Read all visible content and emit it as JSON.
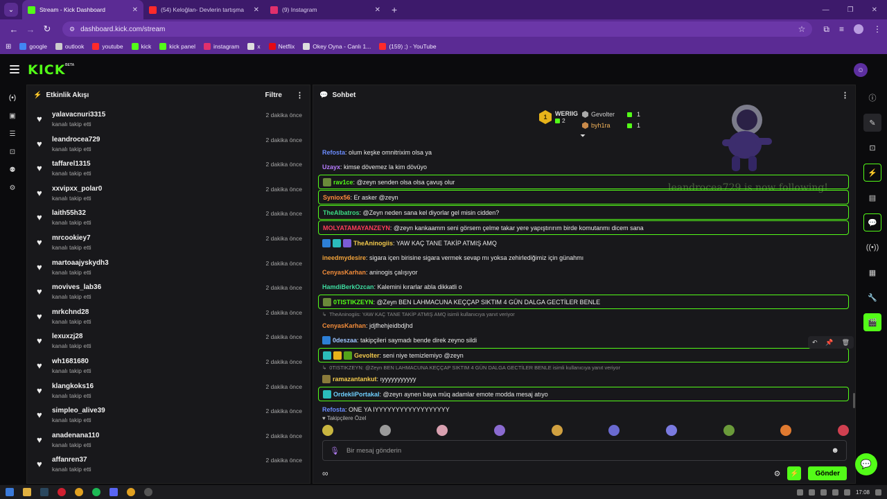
{
  "browser": {
    "tabs": [
      {
        "title": "Stream - Kick Dashboard",
        "active": true,
        "icon": "kick-icon"
      },
      {
        "title": "(54) Keloğlan- Devlerin tartışma",
        "active": false,
        "icon": "youtube-icon"
      },
      {
        "title": "(9) Instagram",
        "active": false,
        "icon": "instagram-icon"
      }
    ],
    "new_tab": "+",
    "url": "dashboard.kick.com/stream",
    "bookmarks": [
      "google",
      "outlook",
      "youtube",
      "kick",
      "kick panel",
      "instagram",
      "x",
      "Netflix",
      "Okey Oyna - Canlı 1...",
      "(159) ;) - YouTube"
    ]
  },
  "app": {
    "logo": "KICK",
    "logo_beta": "BETA",
    "activity": {
      "title": "Etkinlik Akışı",
      "filter": "Filtre",
      "items": [
        {
          "name": "yalavacnuri3315",
          "action": "kanalı takip etti",
          "time": "2 dakika önce"
        },
        {
          "name": "leandrocea729",
          "action": "kanalı takip etti",
          "time": "2 dakika önce"
        },
        {
          "name": "taffarel1315",
          "action": "kanalı takip etti",
          "time": "2 dakika önce"
        },
        {
          "name": "xxvipxx_polar0",
          "action": "kanalı takip etti",
          "time": "2 dakika önce"
        },
        {
          "name": "laith55h32",
          "action": "kanalı takip etti",
          "time": "2 dakika önce"
        },
        {
          "name": "mrcookiey7",
          "action": "kanalı takip etti",
          "time": "2 dakika önce"
        },
        {
          "name": "martoaajyskydh3",
          "action": "kanalı takip etti",
          "time": "2 dakika önce"
        },
        {
          "name": "movives_lab36",
          "action": "kanalı takip etti",
          "time": "2 dakika önce"
        },
        {
          "name": "mrkchnd28",
          "action": "kanalı takip etti",
          "time": "2 dakika önce"
        },
        {
          "name": "lexuxzj28",
          "action": "kanalı takip etti",
          "time": "2 dakika önce"
        },
        {
          "name": "wh1681680",
          "action": "kanalı takip etti",
          "time": "2 dakika önce"
        },
        {
          "name": "klangkoks16",
          "action": "kanalı takip etti",
          "time": "2 dakika önce"
        },
        {
          "name": "simpleo_alive39",
          "action": "kanalı takip etti",
          "time": "2 dakika önce"
        },
        {
          "name": "anadenana110",
          "action": "kanalı takip etti",
          "time": "2 dakika önce"
        },
        {
          "name": "affanren37",
          "action": "kanalı takip etti",
          "time": "2 dakika önce"
        }
      ]
    },
    "chat": {
      "title": "Sohbet",
      "leaderboard": {
        "top": {
          "rank": "1",
          "name": "WERIIG",
          "count": "2"
        },
        "others": [
          {
            "name": "Gevolter",
            "count": "1"
          },
          {
            "name": "byh1ra",
            "count": "1"
          }
        ]
      },
      "follow_alert": "leandrocea729 is now following!",
      "messages": [
        {
          "user": "Refosta",
          "color": "#6b8cff",
          "text": ": olum keşke omnitrixim olsa ya",
          "boxed": false,
          "badges": []
        },
        {
          "user": "Uzayx",
          "color": "#b77cff",
          "text": ": kimse dövemez la kim dövüyo",
          "boxed": false,
          "badges": []
        },
        {
          "user": "rav1ce",
          "color": "#53fc18",
          "text": ": @zeyn senden olsa olsa çavuş olur",
          "boxed": true,
          "badges": [
            "#6a8a3a"
          ]
        },
        {
          "user": "Syniox56",
          "color": "#ff8a3d",
          "text": ": Er asker @zeyn",
          "boxed": true,
          "badges": []
        },
        {
          "user": "TheAlbatros",
          "color": "#3ddc84",
          "text": ": @Zeyn neden sana kel diyorlar gel misin cidden?",
          "boxed": true,
          "badges": []
        },
        {
          "user": "MOLYATAMAYANZEYN",
          "color": "#ff3d5a",
          "text": ": @zeyn kankaamm seni görsem çelme takar yere yapıştırırım birde komutanmı dicem sana",
          "boxed": true,
          "badges": []
        },
        {
          "user": "TheAninogiis",
          "color": "#f2c94c",
          "text": ": YAW KAÇ TANE TAKİP ATMIŞ AMQ",
          "boxed": false,
          "badges": [
            "#2d7fd6",
            "#2bbcbc",
            "#7b5cd6"
          ]
        },
        {
          "user": "ineedmydesire",
          "color": "#f2a33a",
          "text": ": sigara içen birisine sigara vermek sevap mı yoksa zehirlediğimiz için günahmı",
          "boxed": false,
          "badges": []
        },
        {
          "user": "CenyasKarhan",
          "color": "#f28c3a",
          "text": ": aninogis çalışıyor",
          "boxed": false,
          "badges": []
        },
        {
          "user": "HamdiBerkOzcan",
          "color": "#3ddca0",
          "text": ": Kalemini kırarlar abla dikkatli o",
          "boxed": false,
          "badges": []
        },
        {
          "user": "0TISTIKZEYN",
          "color": "#53fc18",
          "text": ": @Zeyn BEN LAHMACUNA KEÇÇAP SIKTIM 4 GÜN DALGA GECTİLER BENLE",
          "boxed": true,
          "badges": [
            "#6a8a3a"
          ]
        },
        {
          "reply": "TheAninogiis: YAW KAÇ TANE TAKİP ATMIŞ AMQ isimli kullanıcıya yanıt veriyor"
        },
        {
          "user": "CenyasKarhan",
          "color": "#f28c3a",
          "text": ": jdjfhehjeidbdjhd",
          "boxed": false,
          "badges": []
        },
        {
          "user": "0deszaa",
          "color": "#9ec5ff",
          "text": ": takipçileri saymadı bende direk zeyno sildi",
          "boxed": false,
          "badges": [
            "#2d7fd6"
          ]
        },
        {
          "user": "Gevolter",
          "color": "#f2c94c",
          "text": ": seni niye temizlemiyo @zeyn",
          "boxed": true,
          "badges": [
            "#2bbcbc",
            "#e7b31a",
            "#53a31a"
          ]
        },
        {
          "reply": "0TISTIKZEYN: @Zeyn BEN LAHMACUNA KEÇÇAP SIKTIM 4 GÜN DALGA GECTİLER BENLE isimli kullanıcıya yanıt veriyor"
        },
        {
          "user": "ramazantankut",
          "color": "#f2c94c",
          "text": ": ıyyyyyyyyyyy",
          "boxed": false,
          "badges": [
            "#8a7a3a"
          ]
        },
        {
          "user": "OrdekliPortakal",
          "color": "#6fd0ff",
          "text": ": @zeyn aynen baya müq adamlar emote modda mesaj atıyo",
          "boxed": true,
          "badges": [
            "#2bbcbc"
          ]
        },
        {
          "user": "Refosta",
          "color": "#6b8cff",
          "text": ": ONE YA IYYYYYYYYYYYYYYYYYY",
          "boxed": false,
          "badges": []
        }
      ],
      "followers_only_label": "Takipçilere Özel",
      "input_placeholder": "Bir mesaj gönderin",
      "send_label": "Gönder"
    }
  },
  "taskbar": {
    "clock": "17:08"
  },
  "colors": {
    "accent": "#53fc18",
    "browser": "#5b2b94"
  }
}
